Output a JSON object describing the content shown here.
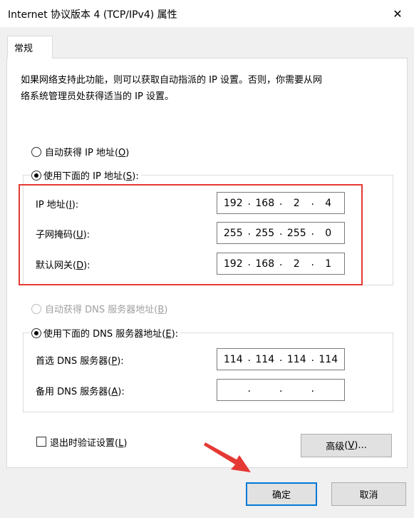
{
  "window": {
    "title": "Internet 协议版本 4 (TCP/IPv4) 属性",
    "close_glyph": "✕"
  },
  "tabs": [
    {
      "label": "常规"
    }
  ],
  "description": {
    "line1": "如果网络支持此功能，则可以获取自动指派的 IP 设置。否则，你需要从网",
    "line2": "络系统管理员处获得适当的 IP 设置。"
  },
  "ip_mode": {
    "auto": {
      "label": "自动获得 IP 地址",
      "key": "O",
      "checked": false
    },
    "manual": {
      "label": "使用下面的 IP 地址",
      "key": "S",
      "checked": true
    }
  },
  "ip_fields": {
    "ip_address": {
      "label": "IP 地址",
      "key": "I",
      "value": [
        "192",
        "168",
        "2",
        "4"
      ]
    },
    "subnet_mask": {
      "label": "子网掩码",
      "key": "U",
      "value": [
        "255",
        "255",
        "255",
        "0"
      ]
    },
    "gateway": {
      "label": "默认网关",
      "key": "D",
      "value": [
        "192",
        "168",
        "2",
        "1"
      ]
    }
  },
  "dns_mode": {
    "auto": {
      "label": "自动获得 DNS 服务器地址",
      "key": "B",
      "checked": false,
      "disabled": true
    },
    "manual": {
      "label": "使用下面的 DNS 服务器地址",
      "key": "E",
      "checked": true
    }
  },
  "dns_fields": {
    "preferred": {
      "label": "首选 DNS 服务器",
      "key": "P",
      "value": [
        "114",
        "114",
        "114",
        "114"
      ]
    },
    "alternate": {
      "label": "备用 DNS 服务器",
      "key": "A",
      "value": [
        "",
        "",
        "",
        ""
      ]
    }
  },
  "validate_on_exit": {
    "label": "退出时验证设置",
    "key": "L",
    "checked": false
  },
  "buttons": {
    "advanced": {
      "label": "高级",
      "key": "V",
      "suffix": "..."
    },
    "ok": "确定",
    "cancel": "取消"
  },
  "colors": {
    "highlight_box": "#e53935",
    "annotation_arrow": "#e53935",
    "default_button_border": "#0078d7"
  }
}
